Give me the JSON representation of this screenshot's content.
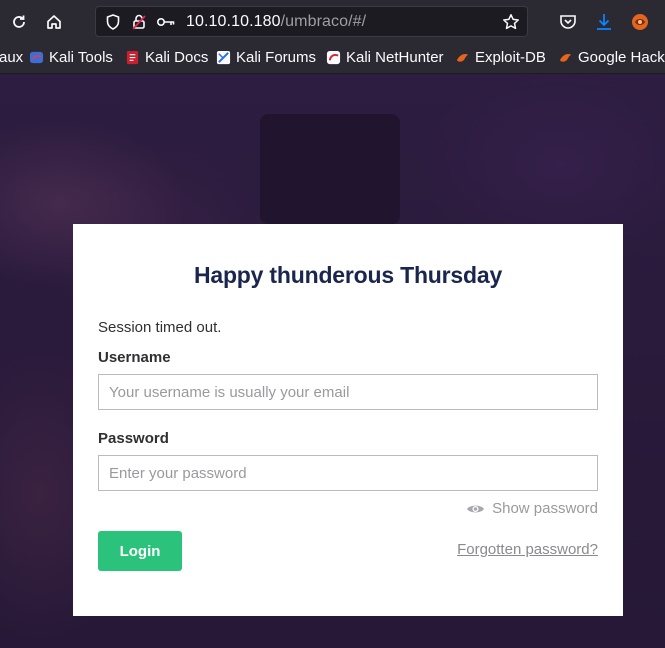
{
  "browser": {
    "url_host": "10.10.10.180",
    "url_path": "/umbraco/#/",
    "bookmarks": [
      {
        "label": "aux",
        "icon": "partial-bookmark-icon"
      },
      {
        "label": "Kali Tools",
        "icon": "kali-tools-icon"
      },
      {
        "label": "Kali Docs",
        "icon": "kali-docs-icon"
      },
      {
        "label": "Kali Forums",
        "icon": "kali-forums-icon"
      },
      {
        "label": "Kali NetHunter",
        "icon": "kali-nethunter-icon"
      },
      {
        "label": "Exploit-DB",
        "icon": "exploit-db-icon"
      },
      {
        "label": "Google Hacki",
        "icon": "google-hacking-icon"
      }
    ]
  },
  "login": {
    "greeting": "Happy thunderous Thursday",
    "message": "Session timed out.",
    "username_label": "Username",
    "username_placeholder": "Your username is usually your email",
    "username_value": "",
    "password_label": "Password",
    "password_placeholder": "Enter your password",
    "password_value": "",
    "show_password": "Show password",
    "login_button": "Login",
    "forgot_link": "Forgotten password?"
  },
  "colors": {
    "accent_green": "#2bc37c",
    "chrome_bg": "#2b2a33",
    "download_blue": "#0a84ff"
  }
}
